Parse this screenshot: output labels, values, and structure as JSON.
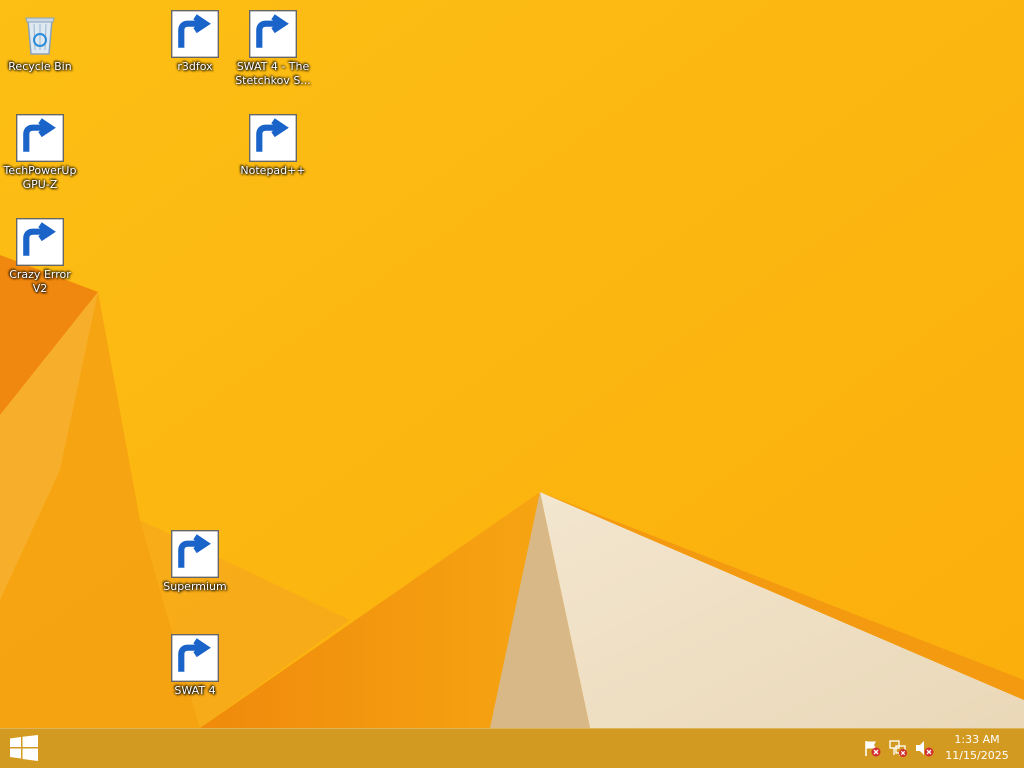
{
  "desktop": {
    "icons": [
      {
        "id": "recycle-bin",
        "label": "Recycle Bin",
        "icon": "recycle-bin-icon",
        "shortcut": false
      },
      {
        "id": "r3dfox",
        "label": "r3dfox",
        "icon": "blank-file-icon",
        "shortcut": true
      },
      {
        "id": "swat4-stetchkov",
        "label": "SWAT 4 - The Stetchkov S...",
        "icon": "swat4-icon",
        "shortcut": true
      },
      {
        "id": "gpuz",
        "label": "TechPowerUp GPU-Z",
        "icon": "gpuz-icon",
        "shortcut": true
      },
      {
        "id": "notepadpp",
        "label": "Notepad++",
        "icon": "notepadpp-icon",
        "shortcut": true
      },
      {
        "id": "crazy-error",
        "label": "Crazy Error V2",
        "icon": "crazy-error-icon",
        "shortcut": true
      },
      {
        "id": "supermium",
        "label": "Supermium",
        "icon": "supermium-icon",
        "shortcut": true
      },
      {
        "id": "swat4",
        "label": "SWAT 4",
        "icon": "swat4-icon",
        "shortcut": true
      }
    ]
  },
  "taskbar": {
    "start_icon": "windows-logo-icon",
    "tray": [
      {
        "id": "action-center",
        "icon": "flag-alert-icon"
      },
      {
        "id": "network",
        "icon": "network-disconnected-icon"
      },
      {
        "id": "volume",
        "icon": "volume-muted-icon"
      }
    ],
    "clock": {
      "time": "1:33 AM",
      "date": "11/15/2025"
    }
  },
  "colors": {
    "wallpaper": "#fcb40c",
    "taskbar": "#d39a22",
    "accent_orange": "#f39212",
    "paper": "#f2e3c8"
  }
}
